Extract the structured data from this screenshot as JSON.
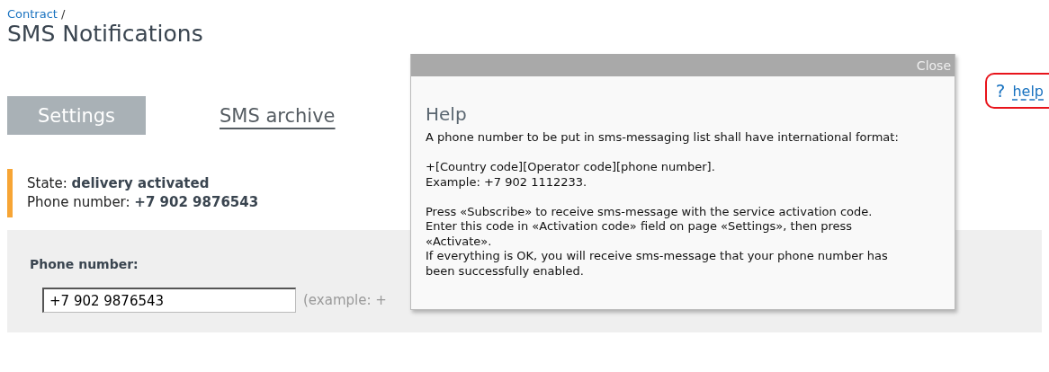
{
  "breadcrumb": {
    "link": "Contract",
    "separator": "/"
  },
  "title": "SMS Notifications",
  "tabs": [
    {
      "label": "Settings",
      "selected": true
    },
    {
      "label": "SMS archive",
      "selected": false
    }
  ],
  "help_link": {
    "icon": "?",
    "label": "help",
    "highlighted": true
  },
  "status": {
    "state_label": "State:",
    "state_value": "delivery activated",
    "phone_label": "Phone number:",
    "phone_value": "+7 902 9876543"
  },
  "form": {
    "label": "Phone number:",
    "value": "+7 902 9876543",
    "hint": "(example: +"
  },
  "popup": {
    "close": "Close",
    "title": "Help",
    "paragraphs": [
      [
        "A phone number to be put in sms-messaging list shall have international format:"
      ],
      [
        "+[Country code][Operator code][phone number].",
        "Example: +7 902 1112233."
      ],
      [
        "Press «Subscribe» to receive sms-message with the service activation code. Enter this code in «Activation code» field on page «Settings», then press «Activate».",
        "If everything is OK, you will receive sms-message that your phone number has been successfully enabled."
      ]
    ]
  }
}
